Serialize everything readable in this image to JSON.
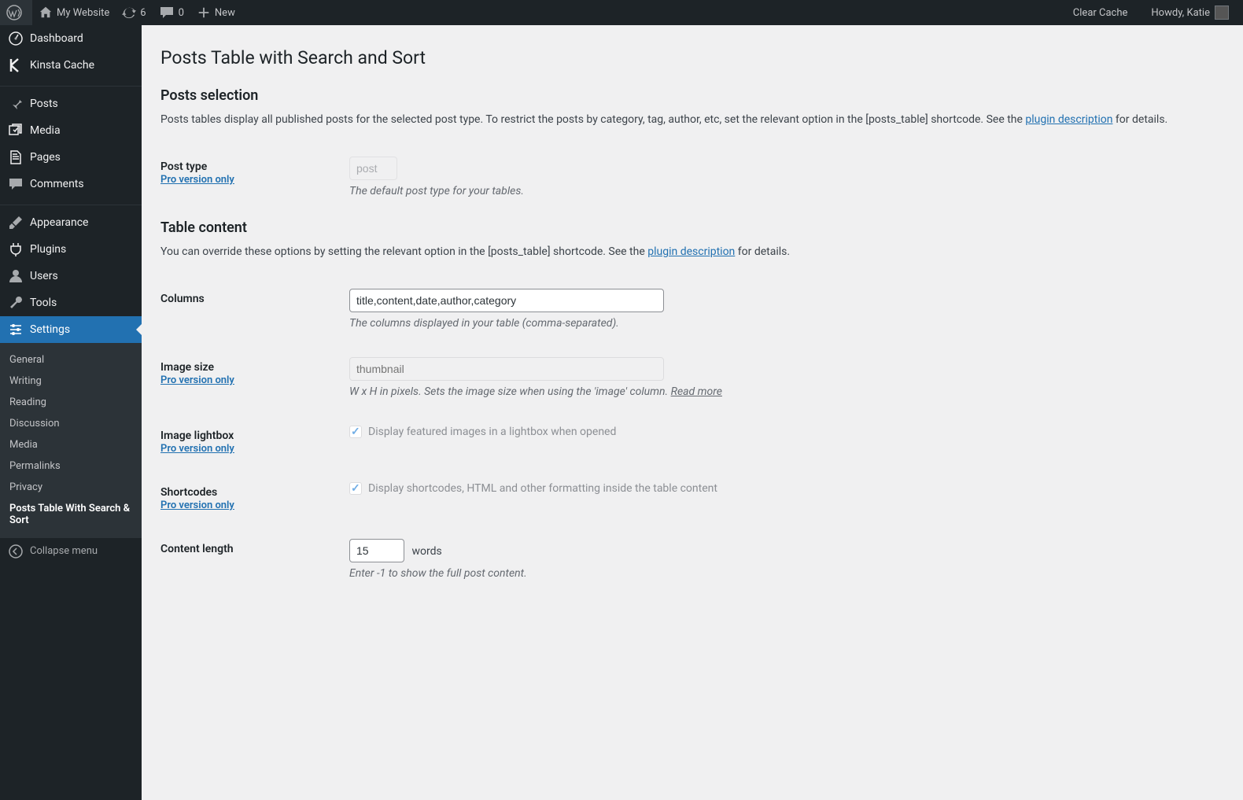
{
  "adminbar": {
    "site_name": "My Website",
    "updates_count": "6",
    "comments_count": "0",
    "new_label": "New",
    "clear_cache": "Clear Cache",
    "howdy": "Howdy, Katie"
  },
  "sidebar": {
    "items": [
      {
        "id": "dashboard",
        "label": "Dashboard",
        "icon": "dashboard-icon"
      },
      {
        "id": "kinsta",
        "label": "Kinsta Cache",
        "icon": "kinsta-icon"
      },
      {
        "id": "posts",
        "label": "Posts",
        "icon": "pin-icon"
      },
      {
        "id": "media",
        "label": "Media",
        "icon": "media-icon"
      },
      {
        "id": "pages",
        "label": "Pages",
        "icon": "pages-icon"
      },
      {
        "id": "comments",
        "label": "Comments",
        "icon": "comment-icon"
      },
      {
        "id": "appearance",
        "label": "Appearance",
        "icon": "brush-icon"
      },
      {
        "id": "plugins",
        "label": "Plugins",
        "icon": "plug-icon"
      },
      {
        "id": "users",
        "label": "Users",
        "icon": "user-icon"
      },
      {
        "id": "tools",
        "label": "Tools",
        "icon": "wrench-icon"
      },
      {
        "id": "settings",
        "label": "Settings",
        "icon": "sliders-icon"
      }
    ],
    "submenu": [
      {
        "label": "General"
      },
      {
        "label": "Writing"
      },
      {
        "label": "Reading"
      },
      {
        "label": "Discussion"
      },
      {
        "label": "Media"
      },
      {
        "label": "Permalinks"
      },
      {
        "label": "Privacy"
      },
      {
        "label": "Posts Table With Search & Sort",
        "current": true
      }
    ],
    "collapse_label": "Collapse menu"
  },
  "page": {
    "title": "Posts Table with Search and Sort",
    "section1": {
      "heading": "Posts selection",
      "desc_prefix": "Posts tables display all published posts for the selected post type. To restrict the posts by category, tag, author, etc, set the relevant option in the [posts_table] shortcode. See the ",
      "desc_link": "plugin description",
      "desc_suffix": " for details."
    },
    "section2": {
      "heading": "Table content",
      "desc_prefix": "You can override these options by setting the relevant option in the [posts_table] shortcode. See the ",
      "desc_link": "plugin description",
      "desc_suffix": " for details."
    },
    "pro_label": "Pro version only",
    "fields": {
      "post_type": {
        "label": "Post type",
        "value": "post",
        "help": "The default post type for your tables."
      },
      "columns": {
        "label": "Columns",
        "value": "title,content,date,author,category",
        "help": "The columns displayed in your table (comma-separated)."
      },
      "image_size": {
        "label": "Image size",
        "placeholder": "thumbnail",
        "help_prefix": "W x H in pixels. Sets the image size when using the 'image' column. ",
        "help_link": "Read more"
      },
      "image_lightbox": {
        "label": "Image lightbox",
        "cb_label": "Display featured images in a lightbox when opened"
      },
      "shortcodes": {
        "label": "Shortcodes",
        "cb_label": "Display shortcodes, HTML and other formatting inside the table content"
      },
      "content_length": {
        "label": "Content length",
        "value": "15",
        "suffix": "words",
        "help": "Enter -1 to show the full post content."
      }
    }
  }
}
